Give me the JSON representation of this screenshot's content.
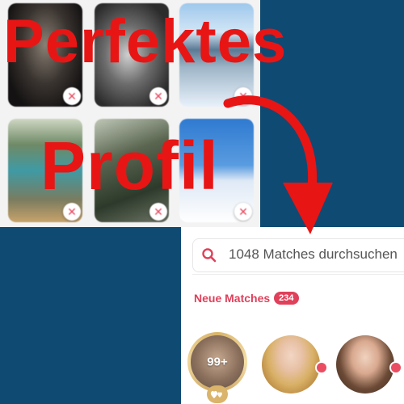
{
  "headline": {
    "line1": "Perfektes",
    "line2": "Profil"
  },
  "photo_grid": {
    "tiles": [
      {
        "remove_label": "✕"
      },
      {
        "remove_label": "✕"
      },
      {
        "remove_label": "✕"
      },
      {
        "remove_label": "✕"
      },
      {
        "remove_label": "✕"
      },
      {
        "remove_label": "✕"
      }
    ]
  },
  "matches": {
    "search_text": "1048 Matches durchsuchen",
    "new_matches_label": "Neue Matches",
    "new_matches_count": "234",
    "likes_count": "99+"
  },
  "colors": {
    "background": "#0f4a73",
    "headline": "#e81515",
    "accent": "#e0405a",
    "gold": "#d9b46a"
  },
  "icons": [
    "close-icon",
    "search-icon",
    "curved-arrow-icon",
    "gold-hearts-icon",
    "online-dot"
  ]
}
